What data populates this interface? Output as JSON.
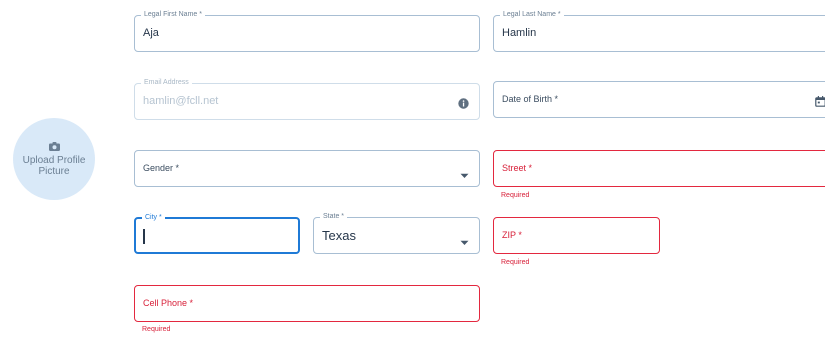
{
  "avatar": {
    "label_line1": "Upload Profile",
    "label_line2": "Picture",
    "icon": "camera-icon"
  },
  "fields": {
    "first_name": {
      "label": "Legal First Name *",
      "value": "Aja"
    },
    "last_name": {
      "label": "Legal Last Name *",
      "value": "Hamlin"
    },
    "email": {
      "label": "Email Address",
      "value": "hamlin@fcll.net",
      "icon": "info-icon"
    },
    "dob": {
      "label": "Date of Birth *",
      "icon": "calendar-icon"
    },
    "gender": {
      "label": "Gender *",
      "icon": "chevron-down-icon"
    },
    "street": {
      "label": "Street *",
      "error": "Required"
    },
    "city": {
      "label": "City *",
      "value": ""
    },
    "state": {
      "label": "State *",
      "value": "Texas",
      "icon": "chevron-down-icon"
    },
    "zip": {
      "label": "ZIP *",
      "error": "Required"
    },
    "cell_phone": {
      "label": "Cell Phone *",
      "error": "Required"
    }
  },
  "colors": {
    "border": "#a8bed3",
    "error": "#e3283f",
    "focus": "#1f7ad6",
    "avatar_bg": "#d9e9f8"
  }
}
